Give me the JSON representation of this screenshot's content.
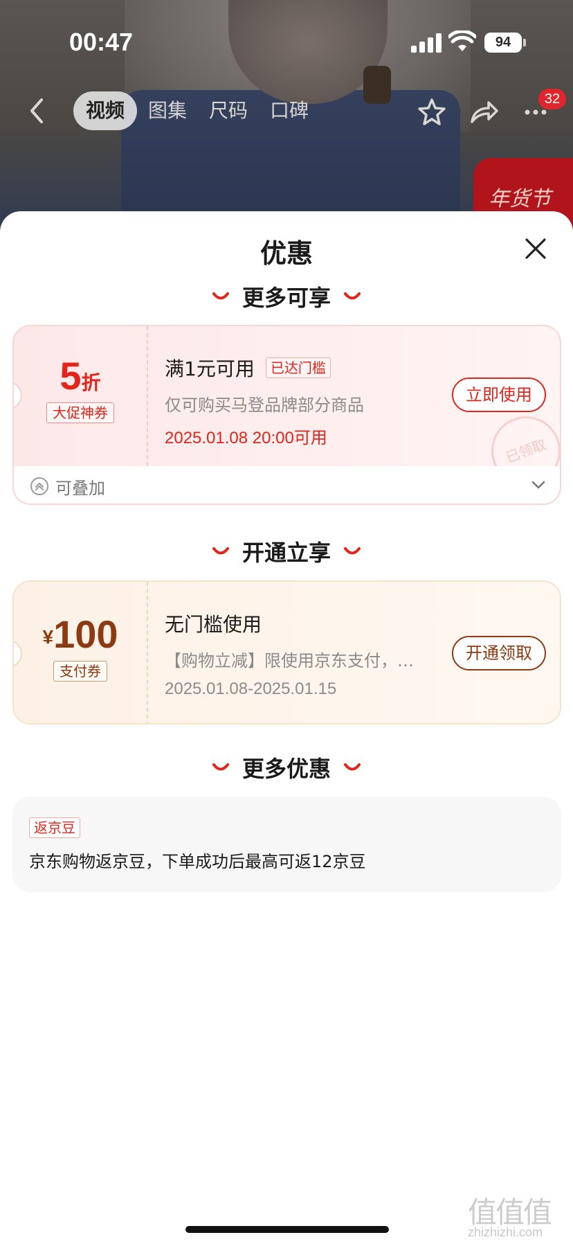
{
  "status_bar": {
    "time": "00:47",
    "battery": "94"
  },
  "nav": {
    "tabs": [
      {
        "label": "视频",
        "active": true
      },
      {
        "label": "图集",
        "active": false
      },
      {
        "label": "尺码",
        "active": false
      },
      {
        "label": "口碑",
        "active": false
      }
    ],
    "message_badge": "32"
  },
  "background": {
    "promo_tag_text": "年货节"
  },
  "sheet": {
    "title": "优惠",
    "sections": {
      "more_available": "更多可享",
      "open_to_enjoy": "开通立享",
      "more_offers": "更多优惠"
    },
    "coupon_discount": {
      "value": "5",
      "unit": "折",
      "type_label": "大促神券",
      "title": "满1元可用",
      "threshold_badge": "已达门槛",
      "description": "仅可购买马登品牌部分商品",
      "valid_time": "2025.01.08 20:00可用",
      "button": "立即使用",
      "stamp": "已领取",
      "stack_label": "可叠加"
    },
    "coupon_payment": {
      "currency": "¥",
      "value": "100",
      "type_label": "支付券",
      "title": "无门槛使用",
      "description": "【购物立减】限使用京东支付，核…",
      "valid_time": "2025.01.08-2025.01.15",
      "button": "开通领取"
    },
    "jingdou": {
      "tag": "返京豆",
      "text": "京东购物返京豆，下单成功后最高可返12京豆"
    }
  },
  "watermark": {
    "glyphs": "值值值",
    "url": "zhizhizhi.com"
  },
  "colors": {
    "accent_red": "#e1251b",
    "accent_brown": "#8b3a12",
    "badge_red": "#e0262c"
  }
}
